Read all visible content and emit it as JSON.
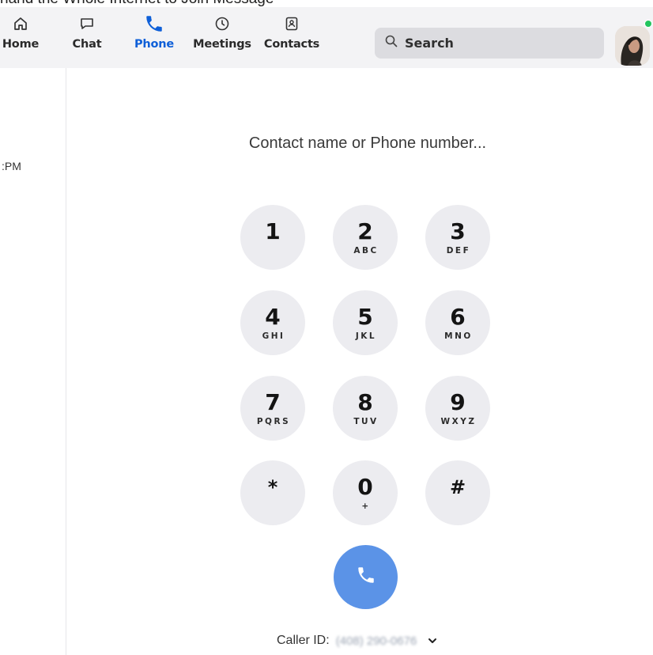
{
  "header_fragment": "hand the Whole Internet to Join Message",
  "nav": {
    "items": [
      {
        "label": "Home",
        "icon": "home-icon"
      },
      {
        "label": "Chat",
        "icon": "chat-icon"
      },
      {
        "label": "Phone",
        "icon": "phone-icon",
        "active": true
      },
      {
        "label": "Meetings",
        "icon": "clock-icon"
      },
      {
        "label": "Contacts",
        "icon": "contacts-icon"
      }
    ],
    "search_label": "Search"
  },
  "left_panel": {
    "time_fragment": ":PM"
  },
  "dialer": {
    "placeholder": "Contact name or Phone number...",
    "keys": [
      {
        "digit": "1",
        "letters": ""
      },
      {
        "digit": "2",
        "letters": "ABC"
      },
      {
        "digit": "3",
        "letters": "DEF"
      },
      {
        "digit": "4",
        "letters": "GHI"
      },
      {
        "digit": "5",
        "letters": "JKL"
      },
      {
        "digit": "6",
        "letters": "MNO"
      },
      {
        "digit": "7",
        "letters": "PQRS"
      },
      {
        "digit": "8",
        "letters": "TUV"
      },
      {
        "digit": "9",
        "letters": "WXYZ"
      },
      {
        "digit": "*",
        "letters": ""
      },
      {
        "digit": "0",
        "letters": "+"
      },
      {
        "digit": "#",
        "letters": ""
      }
    ],
    "caller_id_label": "Caller ID:",
    "caller_id_number": "(408) 290-0676"
  },
  "colors": {
    "accent": "#0e5fd8",
    "call_button": "#5b93e7",
    "key_background": "#ececf0",
    "nav_background": "#f3f3f5",
    "presence": "#22c55e"
  }
}
